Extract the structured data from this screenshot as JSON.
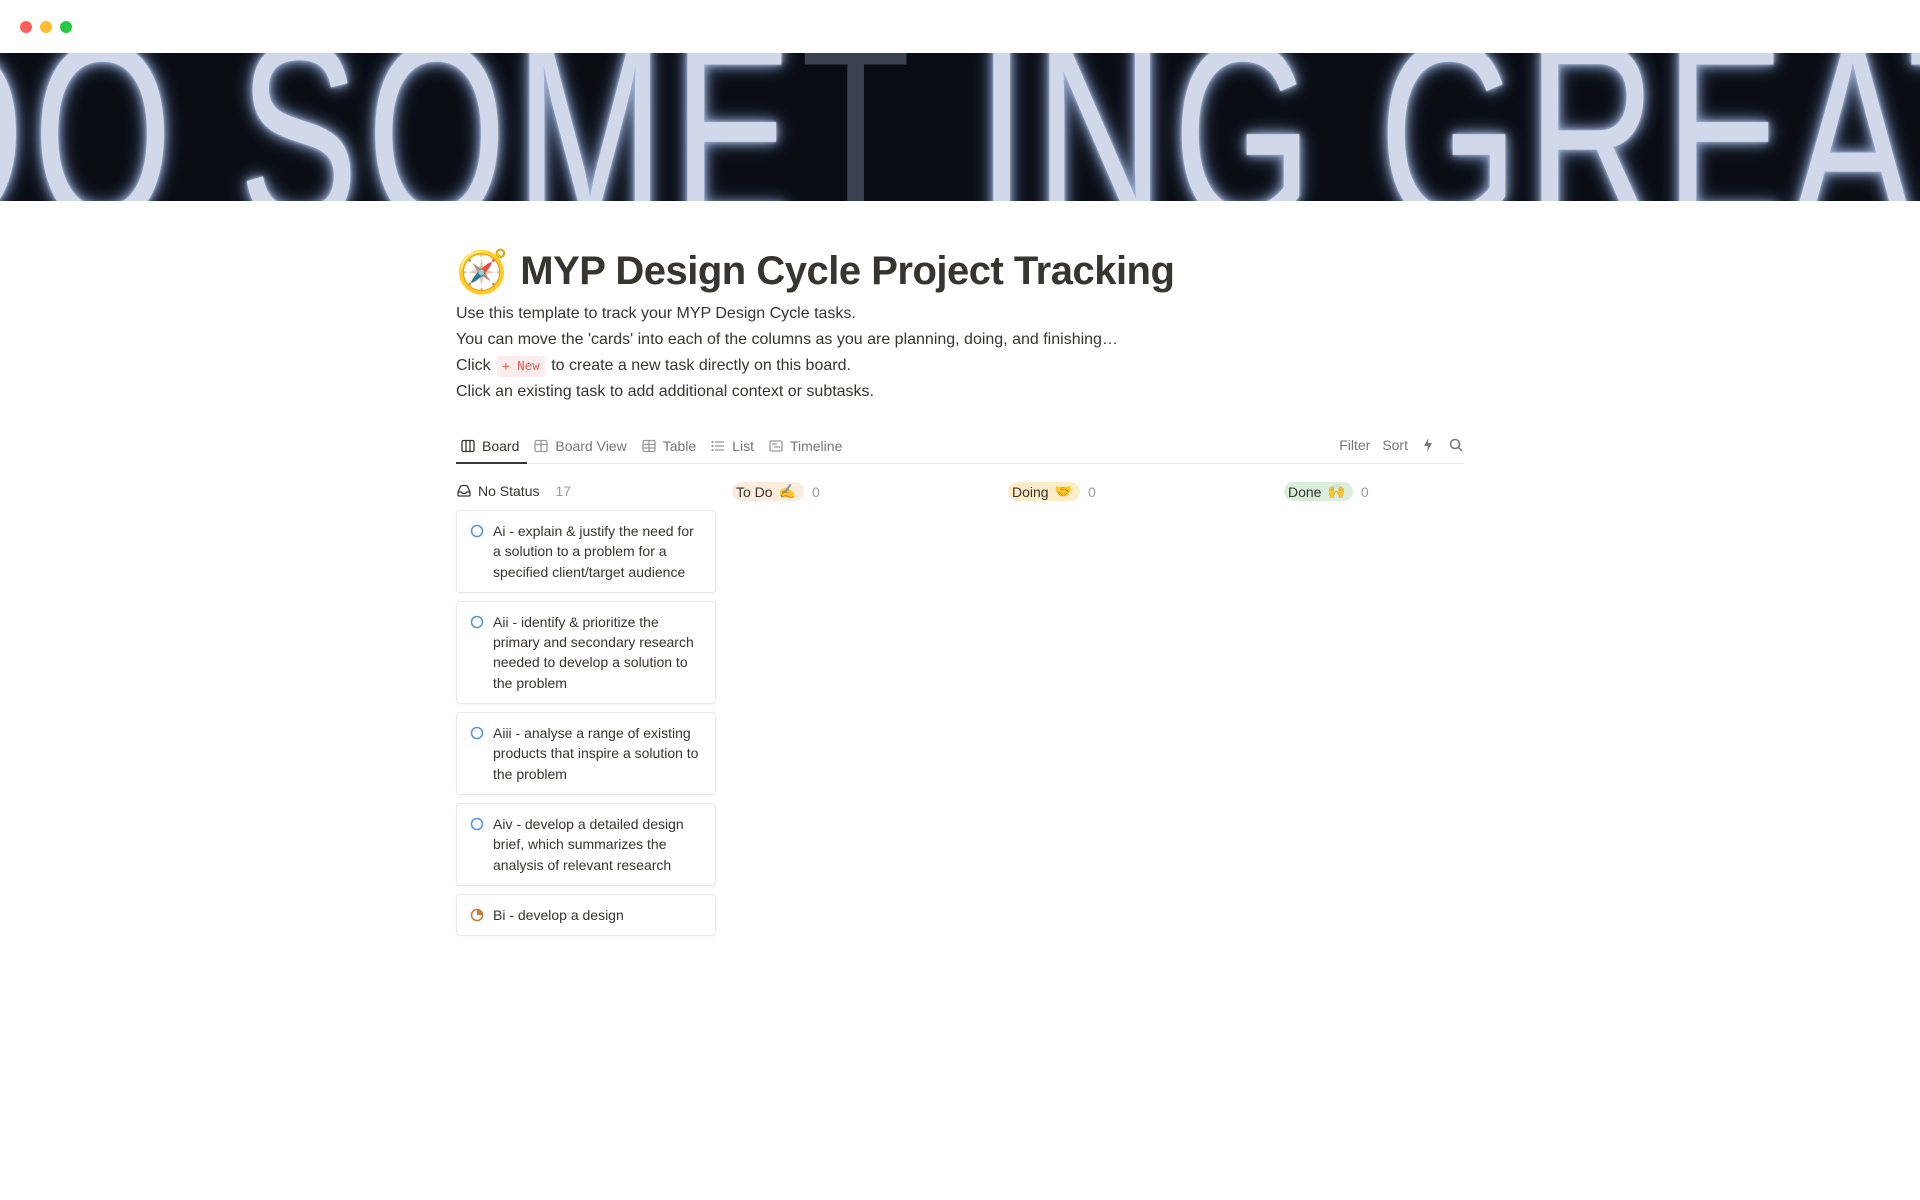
{
  "page": {
    "emoji": "🧭",
    "title": "MYP Design Cycle Project Tracking",
    "desc1": "Use this template to track your MYP Design Cycle tasks.",
    "desc2": "You can move the 'cards' into each of the columns as you are planning, doing, and finishing…",
    "desc3_pre": "Click ",
    "desc3_badge": "+ New",
    "desc3_post": " to create a new task directly on this board.",
    "desc4": "Click an existing task to add additional context or subtasks."
  },
  "views": {
    "tabs": [
      {
        "label": "Board",
        "icon": "board"
      },
      {
        "label": "Board View",
        "icon": "table"
      },
      {
        "label": "Table",
        "icon": "table"
      },
      {
        "label": "List",
        "icon": "list"
      },
      {
        "label": "Timeline",
        "icon": "timeline"
      }
    ],
    "filter": "Filter",
    "sort": "Sort"
  },
  "columns": [
    {
      "id": "nostatus",
      "label": "No Status",
      "count": "17",
      "emoji": ""
    },
    {
      "id": "todo",
      "label": "To Do",
      "count": "0",
      "emoji": "✍️"
    },
    {
      "id": "doing",
      "label": "Doing",
      "count": "0",
      "emoji": "🤝"
    },
    {
      "id": "done",
      "label": "Done",
      "count": "0",
      "emoji": "🙌"
    }
  ],
  "cards": [
    {
      "text": "Ai - explain & justify the need for a solution to a problem for a specified client/target audience",
      "icon": "progress-empty"
    },
    {
      "text": "Aii - identify & prioritize the primary and secondary research needed to develop a solution to the problem",
      "icon": "progress-empty"
    },
    {
      "text": "Aiii - analyse a range of existing products that inspire a solution to the problem",
      "icon": "progress-empty"
    },
    {
      "text": "Aiv - develop a detailed design brief, which summarizes the analysis of relevant research",
      "icon": "progress-empty"
    },
    {
      "text": "Bi - develop a design",
      "icon": "progress-quarter"
    }
  ]
}
